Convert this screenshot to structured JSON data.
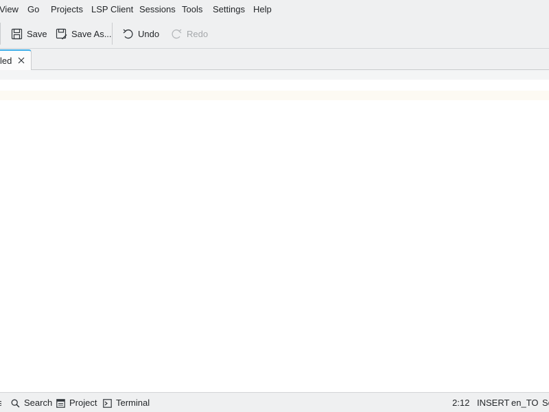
{
  "menubar": {
    "items": [
      "View",
      "Go",
      "Projects",
      "LSP Client",
      "Sessions",
      "Tools",
      "Settings",
      "Help"
    ]
  },
  "toolbar": {
    "save_label": "Save",
    "save_as_label": "Save As...",
    "undo_label": "Undo",
    "redo_label": "Redo"
  },
  "tabs": [
    {
      "label": "led",
      "active": true
    }
  ],
  "statusbar": {
    "search_label": "Search",
    "project_label": "Project",
    "terminal_label": "Terminal",
    "cursor_position": "2:12",
    "input_mode": "INSERT",
    "language": "en_TO",
    "truncated_item": "Sc"
  },
  "colors": {
    "accent": "#3daee9",
    "window_bg": "#eff0f1",
    "editor_bg": "#ffffff",
    "current_line_bg": "#fdfaf3"
  }
}
